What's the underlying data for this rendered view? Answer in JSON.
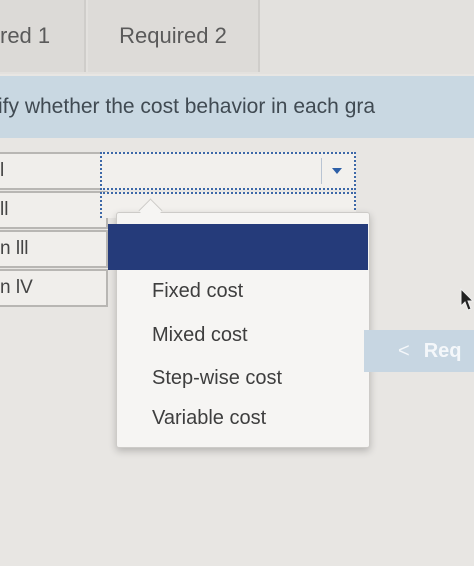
{
  "tabs": [
    {
      "label": "red 1"
    },
    {
      "label": "Required 2"
    }
  ],
  "instruction": "ify whether the cost behavior in each gra",
  "rows": [
    {
      "label": "l"
    },
    {
      "label": "ll"
    },
    {
      "label": "n lll"
    },
    {
      "label": "n lV"
    }
  ],
  "dropdown": {
    "selected": "",
    "options": [
      "Fixed cost",
      "Mixed cost",
      "Step-wise cost",
      "Variable cost"
    ]
  },
  "nav": {
    "back_label": "Req",
    "chevron": "<"
  },
  "colors": {
    "highlight": "#253b7a",
    "instruction_bg": "#c9d8e2",
    "select_border": "#3d68a8"
  }
}
